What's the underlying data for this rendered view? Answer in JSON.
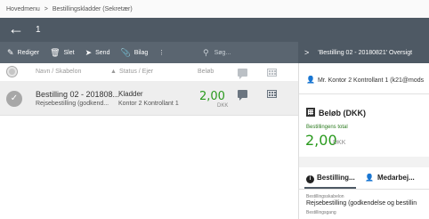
{
  "breadcrumb": {
    "root": "Hovedmenu",
    "separator": ">",
    "current": "Bestillingskladder (Sekretær)"
  },
  "topbar": {
    "count": "1"
  },
  "toolbar": {
    "edit_label": "Rediger",
    "delete_label": "Slet",
    "send_label": "Send",
    "attachment_label": "Bilag",
    "more_label": "⋮",
    "search_placeholder": "Søg..."
  },
  "columns": {
    "name": "Navn / Skabelon",
    "status": "Status / Ejer",
    "amount": "Beløb"
  },
  "rows": [
    {
      "name": "Bestilling 02 - 201808...",
      "template": "Rejsebestilling (godkend...",
      "status": "Kladder",
      "owner": "Kontor 2 Kontrollant 1",
      "amount": "2,00",
      "currency": "DKK"
    }
  ],
  "detail": {
    "title": "'Bestilling 02 - 20180821' Oversigt",
    "user": "Mr. Kontor 2 Kontrollant 1 (k21@mods",
    "amount_heading": "Beløb (DKK)",
    "total_label": "Bestillingens total",
    "total_value": "2,00",
    "total_currency": "DKK",
    "tabs": [
      "Bestilling...",
      "Medarbej..."
    ],
    "fields": [
      {
        "label": "Bestillingsskabelon",
        "value": "Rejsebestilling (godkendelse og bestillin"
      },
      {
        "label": "Bestillingsgang",
        "value": ""
      }
    ]
  },
  "colors": {
    "topbar": "#4e5964",
    "toolbar": "#5a6570",
    "amount_green": "#2a9a1e",
    "row_selected": "#eeeeee"
  }
}
